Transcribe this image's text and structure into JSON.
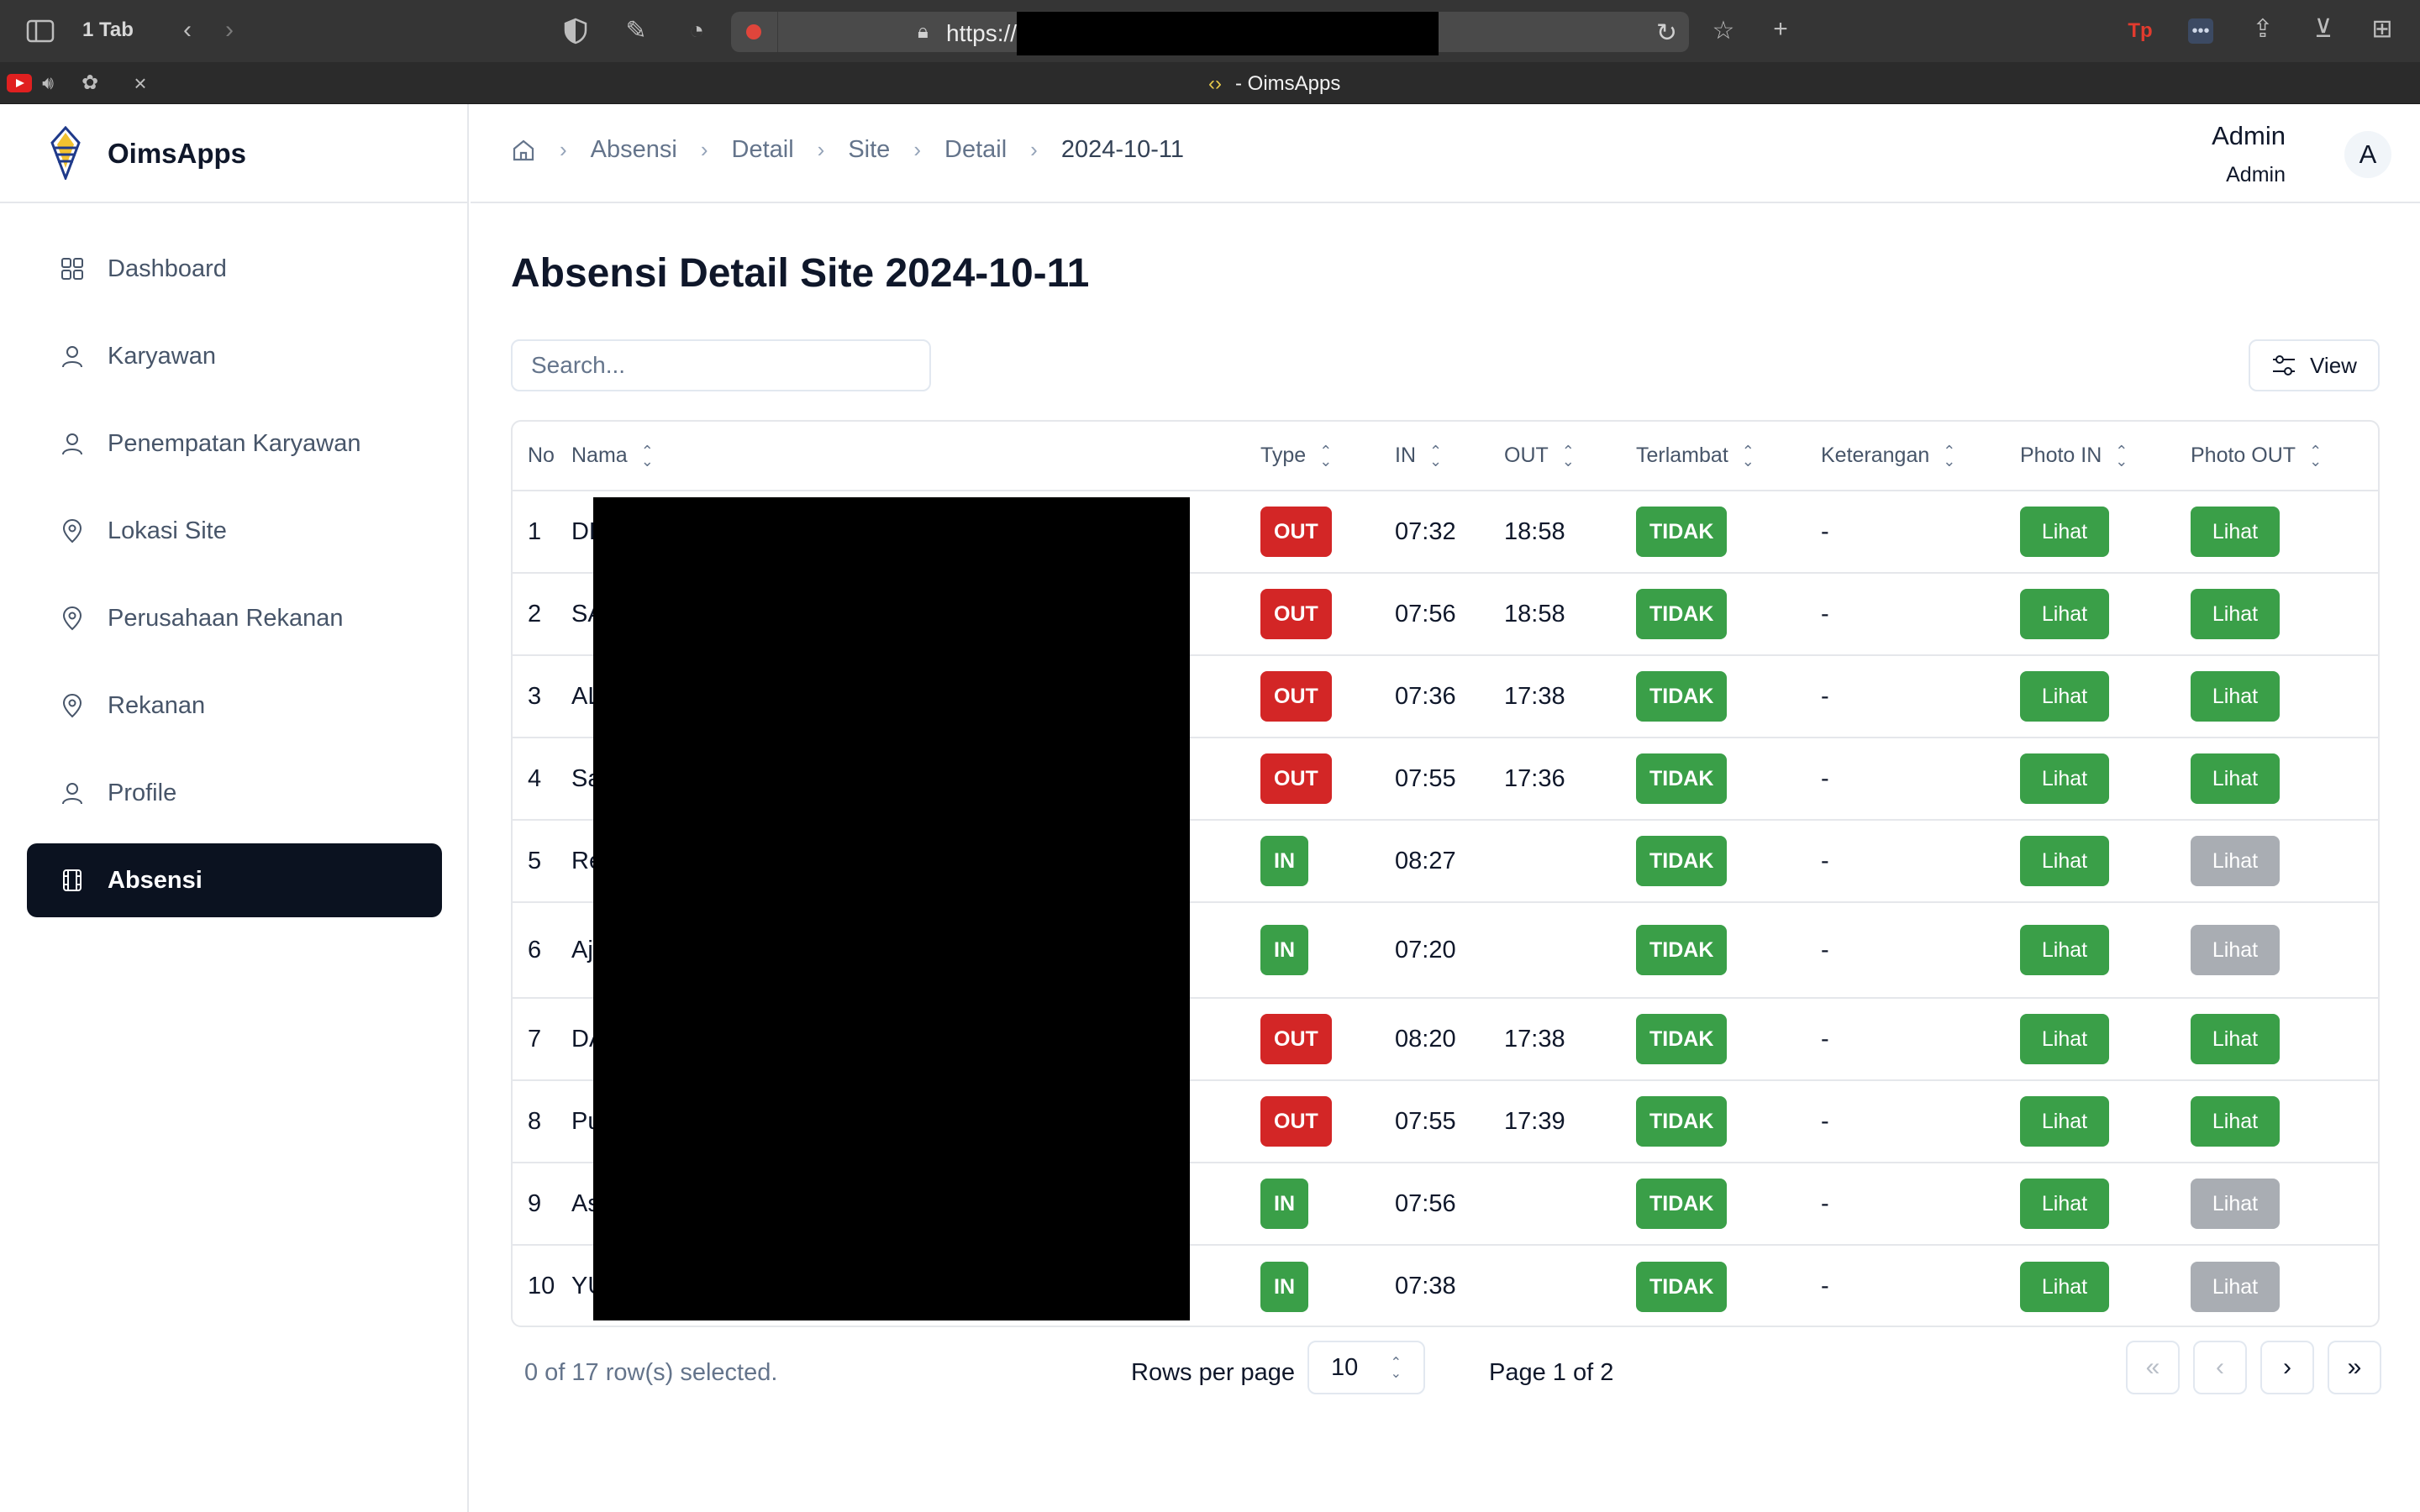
{
  "browser": {
    "tab_count": "1 Tab",
    "url_scheme": "https://",
    "tab_title": "- OimsApps"
  },
  "app": {
    "name": "OimsApps"
  },
  "sidebar": {
    "items": [
      {
        "label": "Dashboard",
        "icon": "grid-icon"
      },
      {
        "label": "Karyawan",
        "icon": "user-icon"
      },
      {
        "label": "Penempatan Karyawan",
        "icon": "user-icon"
      },
      {
        "label": "Lokasi Site",
        "icon": "map-pin-icon"
      },
      {
        "label": "Perusahaan Rekanan",
        "icon": "map-pin-icon"
      },
      {
        "label": "Rekanan",
        "icon": "map-pin-icon"
      },
      {
        "label": "Profile",
        "icon": "user-icon"
      },
      {
        "label": "Absensi",
        "icon": "film-icon",
        "active": true
      }
    ]
  },
  "breadcrumb": [
    "Absensi",
    "Detail",
    "Site",
    "Detail",
    "2024-10-11"
  ],
  "user": {
    "name": "Admin",
    "role": "Admin",
    "initial": "A"
  },
  "page": {
    "title": "Absensi Detail Site 2024-10-11",
    "search_placeholder": "Search...",
    "view_label": "View"
  },
  "table": {
    "headers": [
      "No",
      "Nama",
      "Type",
      "IN",
      "OUT",
      "Terlambat",
      "Keterangan",
      "Photo IN",
      "Photo OUT"
    ],
    "rows": [
      {
        "no": "1",
        "nama": "DH",
        "type": "OUT",
        "in": "07:32",
        "out": "18:58",
        "terlambat": "TIDAK",
        "keterangan": "-",
        "photo_in": "Lihat",
        "photo_out": "Lihat",
        "photo_out_enabled": true
      },
      {
        "no": "2",
        "nama": "SA",
        "type": "OUT",
        "in": "07:56",
        "out": "18:58",
        "terlambat": "TIDAK",
        "keterangan": "-",
        "photo_in": "Lihat",
        "photo_out": "Lihat",
        "photo_out_enabled": true
      },
      {
        "no": "3",
        "nama": "AL",
        "type": "OUT",
        "in": "07:36",
        "out": "17:38",
        "terlambat": "TIDAK",
        "keterangan": "-",
        "photo_in": "Lihat",
        "photo_out": "Lihat",
        "photo_out_enabled": true
      },
      {
        "no": "4",
        "nama": "Sa",
        "type": "OUT",
        "in": "07:55",
        "out": "17:36",
        "terlambat": "TIDAK",
        "keterangan": "-",
        "photo_in": "Lihat",
        "photo_out": "Lihat",
        "photo_out_enabled": true
      },
      {
        "no": "5",
        "nama": "Re",
        "type": "IN",
        "in": "08:27",
        "out": "",
        "terlambat": "TIDAK",
        "keterangan": "-",
        "photo_in": "Lihat",
        "photo_out": "Lihat",
        "photo_out_enabled": false
      },
      {
        "no": "6",
        "nama": "Aja Ge",
        "type": "IN",
        "in": "07:20",
        "out": "",
        "terlambat": "TIDAK",
        "keterangan": "-",
        "photo_in": "Lihat",
        "photo_out": "Lihat",
        "photo_out_enabled": false
      },
      {
        "no": "7",
        "nama": "DA",
        "type": "OUT",
        "in": "08:20",
        "out": "17:38",
        "terlambat": "TIDAK",
        "keterangan": "-",
        "photo_in": "Lihat",
        "photo_out": "Lihat",
        "photo_out_enabled": true
      },
      {
        "no": "8",
        "nama": "Pu",
        "type": "OUT",
        "in": "07:55",
        "out": "17:39",
        "terlambat": "TIDAK",
        "keterangan": "-",
        "photo_in": "Lihat",
        "photo_out": "Lihat",
        "photo_out_enabled": true
      },
      {
        "no": "9",
        "nama": "As",
        "type": "IN",
        "in": "07:56",
        "out": "",
        "terlambat": "TIDAK",
        "keterangan": "-",
        "photo_in": "Lihat",
        "photo_out": "Lihat",
        "photo_out_enabled": false
      },
      {
        "no": "10",
        "nama": "YU",
        "type": "IN",
        "in": "07:38",
        "out": "",
        "terlambat": "TIDAK",
        "keterangan": "-",
        "photo_in": "Lihat",
        "photo_out": "Lihat",
        "photo_out_enabled": false
      }
    ]
  },
  "footer": {
    "selection": "0 of 17 row(s) selected.",
    "rows_per_page_label": "Rows per page",
    "rows_per_page_value": "10",
    "page_info": "Page 1 of 2"
  },
  "colors": {
    "out_badge": "#d32626",
    "in_badge": "#3a9f48",
    "lihat_enabled": "#3a9f48",
    "lihat_disabled": "#a9adb3",
    "active_nav": "#0b1220"
  }
}
